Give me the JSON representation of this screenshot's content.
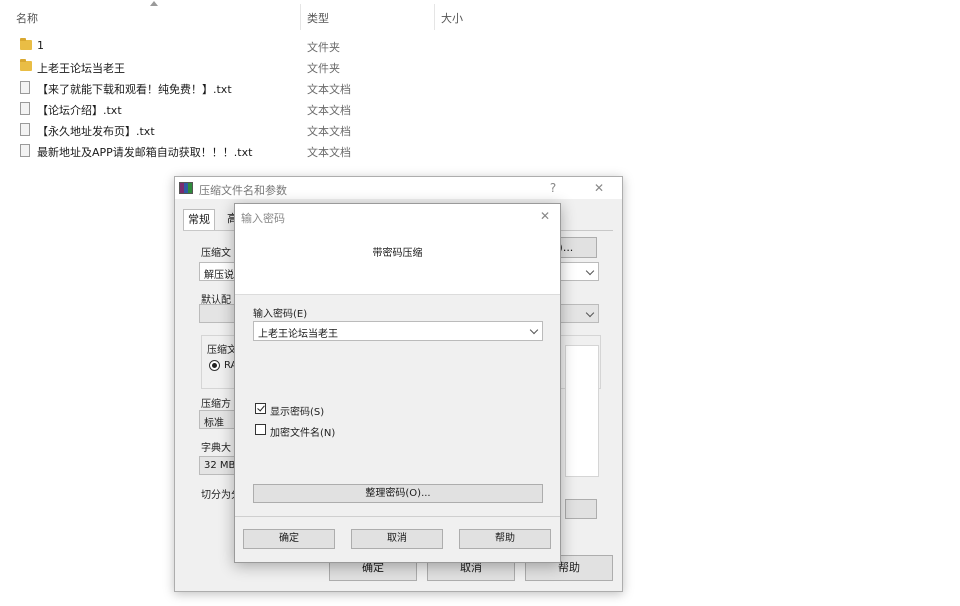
{
  "explorer": {
    "columns": {
      "name": "名称",
      "type": "类型",
      "size": "大小"
    },
    "files": [
      {
        "name": "1",
        "type": "文件夹",
        "icon": "folder-icon"
      },
      {
        "name": "上老王论坛当老王",
        "type": "文件夹",
        "icon": "folder-icon"
      },
      {
        "name": "【来了就能下载和观看！纯免费！】.txt",
        "type": "文本文档",
        "icon": "file-icon"
      },
      {
        "name": "【论坛介绍】.txt",
        "type": "文本文档",
        "icon": "file-icon"
      },
      {
        "name": "【永久地址发布页】.txt",
        "type": "文本文档",
        "icon": "file-icon"
      },
      {
        "name": "最新地址及APP请发邮箱自动获取！！！.txt",
        "type": "文本文档",
        "icon": "file-icon"
      }
    ]
  },
  "archive_dialog": {
    "title": "压缩文件名和参数",
    "help_glyph": "?",
    "close_glyph": "✕",
    "tabs": [
      "常规",
      "高"
    ],
    "labels": {
      "archive_name": "压缩文",
      "default_profile": "默认配",
      "format_group": "压缩文",
      "format_option": "RA",
      "method": "压缩方",
      "dict_size": "字典大",
      "split": "切分为分"
    },
    "values": {
      "archive_name": "解压说",
      "method": "标准",
      "dict_size": "32 MB"
    },
    "browse_button": "(B)...",
    "ok": "确定",
    "cancel": "取消",
    "help": "帮助"
  },
  "password_dialog": {
    "title": "输入密码",
    "close_glyph": "✕",
    "banner": "带密码压缩",
    "password_label": "输入密码(E)",
    "password_value": "上老王论坛当老王",
    "show_password": "显示密码(S)",
    "show_password_checked": true,
    "encrypt_names": "加密文件名(N)",
    "encrypt_names_checked": false,
    "organize_button": "整理密码(O)...",
    "ok": "确定",
    "cancel": "取消",
    "help": "帮助"
  }
}
